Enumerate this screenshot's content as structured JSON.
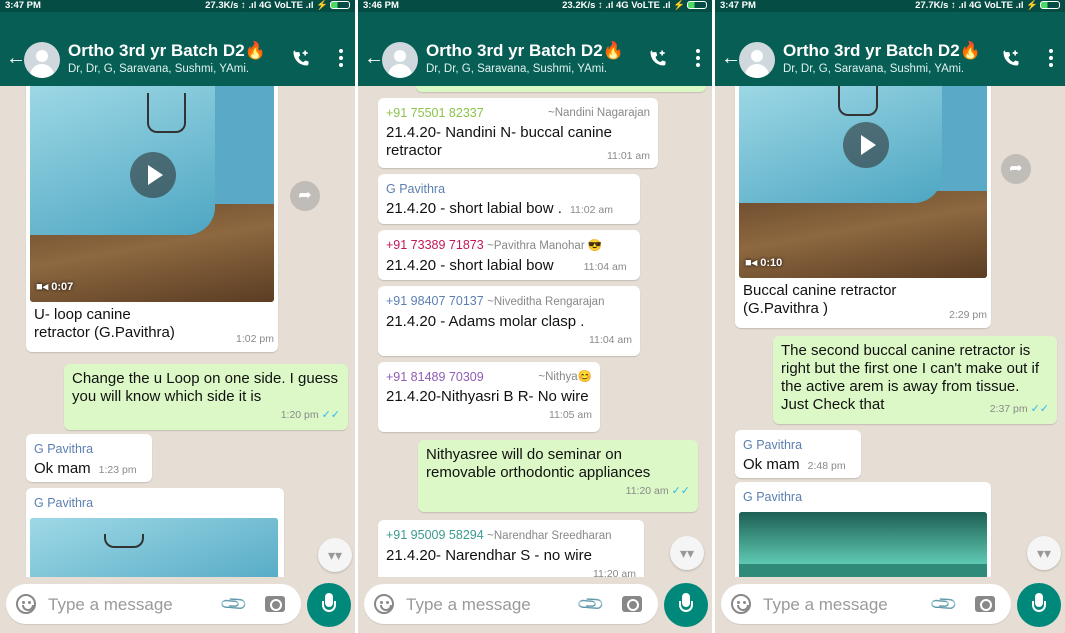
{
  "panels": [
    {
      "status": {
        "time": "3:47 PM",
        "speed": "27.3K/s",
        "network": "4G VoLTE"
      },
      "header": {
        "title": "Ortho 3rd yr Batch D2🔥",
        "subtitle": "Dr, Dr, G, Saravana, Sushmi, YAmi..."
      },
      "messages": [
        {
          "video_duration": "0:07",
          "caption": "U- loop canine retractor (G.Pavithra)",
          "time": "1:02 pm"
        },
        {
          "text": "Change the u Loop on one side. I guess you will know which side it is",
          "time": "1:20 pm"
        },
        {
          "sender": "G Pavithra",
          "text": "Ok mam",
          "time": "1:23 pm"
        },
        {
          "sender": "G Pavithra"
        }
      ],
      "input": {
        "placeholder": "Type a message"
      }
    },
    {
      "status": {
        "time": "3:46 PM",
        "speed": "23.2K/s",
        "network": "4G VoLTE"
      },
      "header": {
        "title": "Ortho 3rd yr Batch D2🔥",
        "subtitle": "Dr, Dr, G, Saravana, Sushmi, YAmi..."
      },
      "messages": [
        {
          "sender": "+91 75501 82337",
          "alias": "~Nandini Nagarajan",
          "text": "21.4.20- Nandini N- buccal canine retractor",
          "time": "11:01 am"
        },
        {
          "sender": "G Pavithra",
          "text": "21.4.20 - short labial bow .",
          "time": "11:02 am"
        },
        {
          "sender": "+91 73389 71873",
          "alias": "~Pavithra Manohar 😎",
          "text": "21.4.20 - short labial bow",
          "time": "11:04 am"
        },
        {
          "sender": "+91 98407 70137",
          "alias": "~Niveditha Rengarajan",
          "text": "21.4.20 - Adams molar clasp .",
          "time": "11:04 am"
        },
        {
          "sender": "+91 81489 70309",
          "alias": "~Nithya😊",
          "text": "21.4.20-Nithyasri B R- No wire",
          "time": "11:05 am"
        },
        {
          "text": "Nithyasree will do seminar on removable orthodontic appliances",
          "time": "11:20 am"
        },
        {
          "sender": "+91 95009 58294",
          "alias": "~Narendhar Sreedharan",
          "text": "21.4.20- Narendhar S - no wire",
          "time": "11:20 am"
        }
      ],
      "input": {
        "placeholder": "Type a message"
      }
    },
    {
      "status": {
        "time": "3:47 PM",
        "speed": "27.7K/s",
        "network": "4G VoLTE"
      },
      "header": {
        "title": "Ortho 3rd yr Batch D2🔥",
        "subtitle": "Dr, Dr, G, Saravana, Sushmi, YAmi..."
      },
      "messages": [
        {
          "video_duration": "0:10",
          "caption": "Buccal canine retractor (G.Pavithra )",
          "time": "2:29 pm"
        },
        {
          "text": "The second buccal canine retractor is right but the first one I can't make out if the active arem is away from tissue. Just Check that",
          "time": "2:37 pm"
        },
        {
          "sender": "G Pavithra",
          "text": "Ok mam",
          "time": "2:48 pm"
        },
        {
          "sender": "G Pavithra"
        }
      ],
      "input": {
        "placeholder": "Type a message"
      }
    }
  ],
  "icons": {
    "back": "arrow-back-icon",
    "call": "add-call-icon",
    "menu": "more-vert-icon",
    "play": "play-icon",
    "forward": "forward-icon",
    "scroll": "chevron-double-down-icon",
    "emoji": "emoji-icon",
    "attach": "paperclip-icon",
    "camera": "camera-icon",
    "mic": "mic-icon"
  },
  "colors": {
    "header": "#075e54",
    "outgoing": "#dcf8c6",
    "incoming": "#ffffff",
    "chat_bg": "#e6ded4",
    "read_ticks": "#34b7f1",
    "sender_green": "#8bc34a",
    "sender_magenta": "#c2185b",
    "sender_blue": "#5c7fb0",
    "sender_purple": "#8e5db5",
    "sender_teal": "#3a9a8f"
  }
}
